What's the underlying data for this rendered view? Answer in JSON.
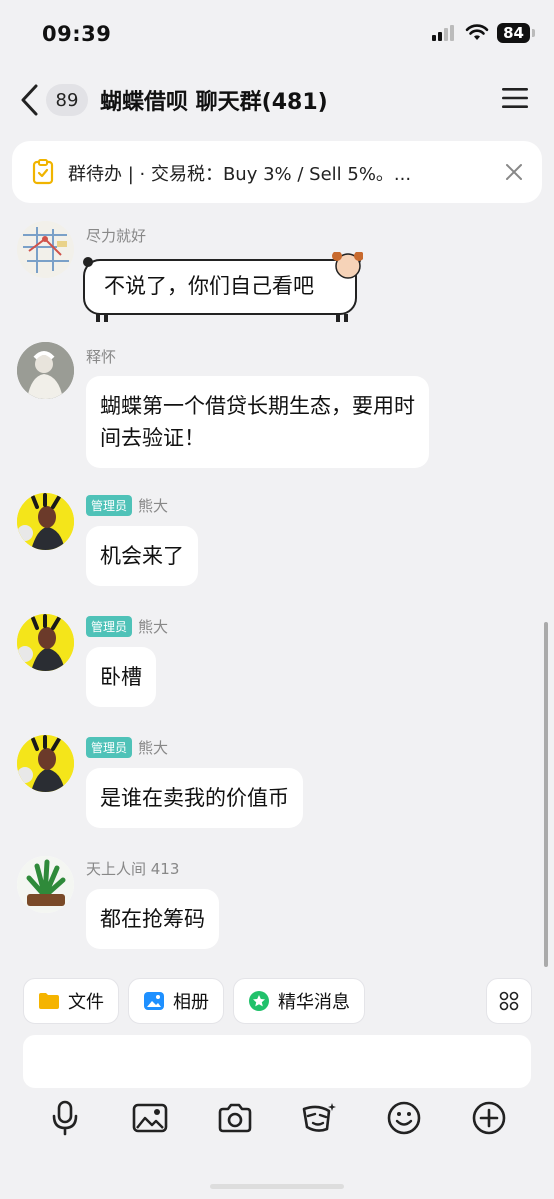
{
  "status": {
    "time": "09:39",
    "battery": "84"
  },
  "nav": {
    "unread_count": "89",
    "title": "蝴蝶借呗 聊天群(481)"
  },
  "notice": {
    "text": "群待办 | · 交易税：Buy 3% / Sell 5%。..."
  },
  "messages": [
    {
      "sender": "尽力就好",
      "text": "不说了，你们自己看吧",
      "admin": false
    },
    {
      "sender": "释怀",
      "text_line1": "蝴蝶第一个借贷长期生态，要用时",
      "text_line2": "间去验证！",
      "admin": false
    },
    {
      "sender": "熊大",
      "badge": "管理员",
      "text": "机会来了",
      "admin": true
    },
    {
      "sender": "熊大",
      "badge": "管理员",
      "text": "卧槽",
      "admin": true
    },
    {
      "sender": "熊大",
      "badge": "管理员",
      "text": "是谁在卖我的价值币",
      "admin": true
    },
    {
      "sender": "天上人间 413",
      "text": "都在抢筹码",
      "admin": false
    }
  ],
  "quick_actions": {
    "file": "文件",
    "album": "相册",
    "essence": "精华消息"
  },
  "colors": {
    "admin_badge": "#4fc2b8",
    "file_icon": "#f5b400",
    "album_icon": "#1e90ff",
    "essence_icon": "#21c16b"
  },
  "toolbar_icons": [
    "microphone-icon",
    "image-icon",
    "camera-icon",
    "sticker-icon",
    "emoji-icon",
    "plus-icon"
  ]
}
